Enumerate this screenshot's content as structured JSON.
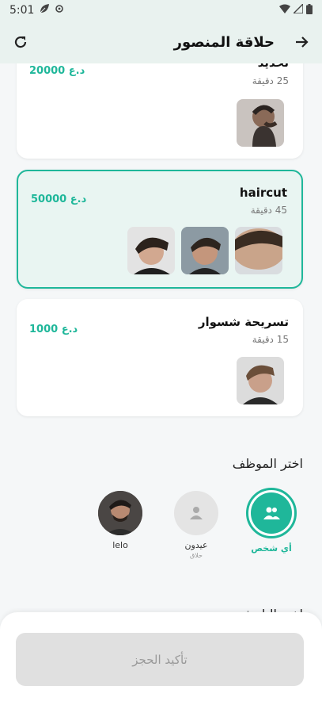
{
  "status": {
    "time": "5:01"
  },
  "app": {
    "title": "حلاقة المنصور"
  },
  "services": [
    {
      "name": "تحديد",
      "duration": "25 دقيقة",
      "price": "20000 د.ع"
    },
    {
      "name": "haircut",
      "duration": "45 دقيقة",
      "price": "50000 د.ع"
    },
    {
      "name": "تسريحة شسوار",
      "duration": "15 دقيقة",
      "price": "1000 د.ع"
    }
  ],
  "employees_section": {
    "title": "اختر الموظف"
  },
  "employees": [
    {
      "name": "أي شخص",
      "sub": ""
    },
    {
      "name": "عيدون",
      "sub": "حلاق"
    },
    {
      "name": "lelo",
      "sub": ""
    }
  ],
  "date_section": {
    "title": "اختر التاريخ"
  },
  "confirm": {
    "label": "تأكيد الحجز"
  },
  "colors": {
    "accent": "#1fb79a",
    "app_bar": "#e9f2ef"
  }
}
